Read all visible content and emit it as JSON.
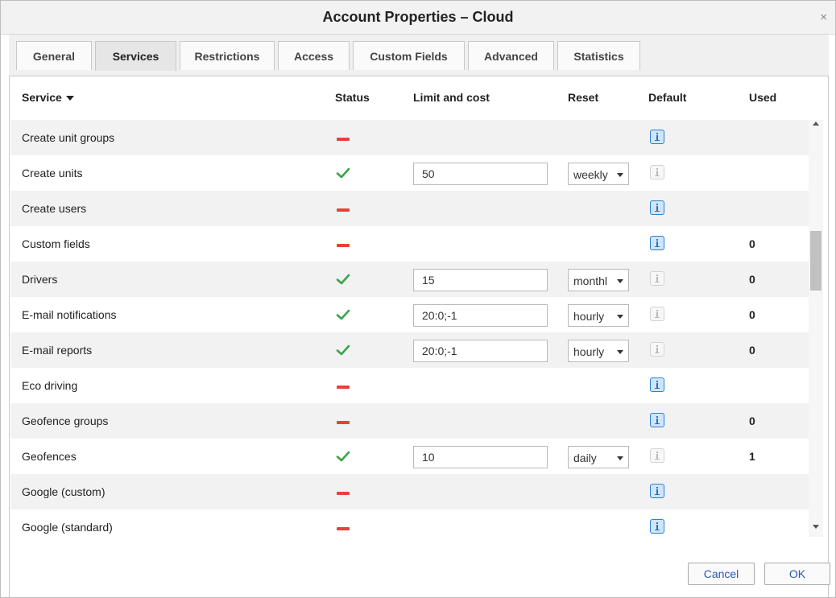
{
  "window": {
    "title": "Account Properties – Cloud",
    "close_glyph": "×"
  },
  "tabs": [
    {
      "label": "General",
      "active": false
    },
    {
      "label": "Services",
      "active": true
    },
    {
      "label": "Restrictions",
      "active": false
    },
    {
      "label": "Access",
      "active": false
    },
    {
      "label": "Custom Fields",
      "active": false
    },
    {
      "label": "Advanced",
      "active": false
    },
    {
      "label": "Statistics",
      "active": false
    }
  ],
  "columns": {
    "service": "Service",
    "status": "Status",
    "limit": "Limit and cost",
    "reset": "Reset",
    "default": "Default",
    "used": "Used"
  },
  "rows": [
    {
      "name": "Create unit groups",
      "enabled": false,
      "limit": "",
      "reset": "",
      "default_on": true,
      "used": ""
    },
    {
      "name": "Create units",
      "enabled": true,
      "limit": "50",
      "reset": "weekly",
      "default_on": false,
      "used": ""
    },
    {
      "name": "Create users",
      "enabled": false,
      "limit": "",
      "reset": "",
      "default_on": true,
      "used": ""
    },
    {
      "name": "Custom fields",
      "enabled": false,
      "limit": "",
      "reset": "",
      "default_on": true,
      "used": "0"
    },
    {
      "name": "Drivers",
      "enabled": true,
      "limit": "15",
      "reset": "monthl",
      "default_on": false,
      "used": "0"
    },
    {
      "name": "E-mail notifications",
      "enabled": true,
      "limit": "20:0;-1",
      "reset": "hourly",
      "default_on": false,
      "used": "0"
    },
    {
      "name": "E-mail reports",
      "enabled": true,
      "limit": "20:0;-1",
      "reset": "hourly",
      "default_on": false,
      "used": "0"
    },
    {
      "name": "Eco driving",
      "enabled": false,
      "limit": "",
      "reset": "",
      "default_on": true,
      "used": ""
    },
    {
      "name": "Geofence groups",
      "enabled": false,
      "limit": "",
      "reset": "",
      "default_on": true,
      "used": "0"
    },
    {
      "name": "Geofences",
      "enabled": true,
      "limit": "10",
      "reset": "daily",
      "default_on": false,
      "used": "1"
    },
    {
      "name": "Google (custom)",
      "enabled": false,
      "limit": "",
      "reset": "",
      "default_on": true,
      "used": ""
    },
    {
      "name": "Google (standard)",
      "enabled": false,
      "limit": "",
      "reset": "",
      "default_on": true,
      "used": ""
    }
  ],
  "buttons": {
    "cancel": "Cancel",
    "ok": "OK"
  },
  "colors": {
    "status_enabled": "#3aa54a",
    "status_disabled": "#e8403a",
    "default_on": "#2f7fd4",
    "button_text": "#2a5aa8"
  },
  "scroll": {
    "thumb_fraction": 0.15,
    "position_fraction": 0.3
  }
}
